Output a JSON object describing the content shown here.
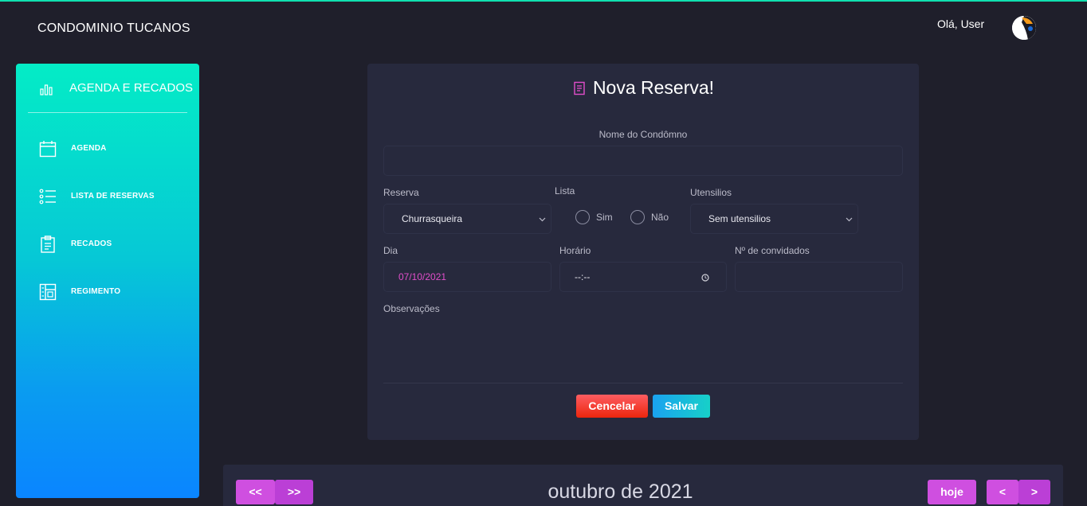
{
  "header": {
    "brand": "CONDOMINIO TUCANOS",
    "greeting": "Olá, User"
  },
  "sidebar": {
    "title": "AGENDA E RECADOS",
    "items": [
      {
        "label": "AGENDA",
        "icon": "calendar-icon"
      },
      {
        "label": "LISTA DE RESERVAS",
        "icon": "list-icon"
      },
      {
        "label": "RECADOS",
        "icon": "clipboard-icon"
      },
      {
        "label": "REGIMENTO",
        "icon": "layout-icon"
      }
    ]
  },
  "form": {
    "title": "Nova Reserva!",
    "name_label": "Nome do Condômno",
    "name_value": "",
    "reserva_label": "Reserva",
    "reserva_value": "Churrasqueira",
    "lista_label": "Lista",
    "lista_options": [
      "Sim",
      "Não"
    ],
    "utensilios_label": "Utensilios",
    "utensilios_value": "Sem utensilios",
    "dia_label": "Dia",
    "dia_value": "07/10/2021",
    "horario_label": "Horário",
    "horario_value": "--:--",
    "convidados_label": "Nº de convidados",
    "convidados_value": "",
    "obs_label": "Observações",
    "cancel_label": "Cencelar",
    "save_label": "Salvar"
  },
  "calendar": {
    "prev_year": "<<",
    "next_year": ">>",
    "title": "outubro de 2021",
    "today": "hoje",
    "prev": "<",
    "next": ">"
  },
  "colors": {
    "accent_teal": "#04ecc6",
    "accent_blue": "#0a85ff",
    "accent_pink": "#e14eca",
    "cancel": "#ec250d",
    "card": "#27293d",
    "background": "#1f1f2b"
  }
}
